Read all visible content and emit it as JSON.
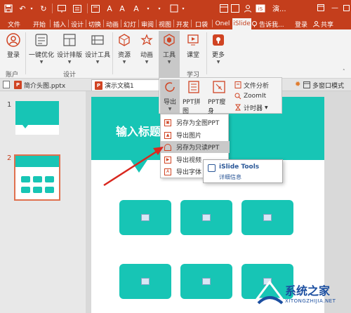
{
  "title_bar": {
    "title": "演...",
    "quick_access": [
      "save-icon",
      "undo-icon",
      "redo-icon",
      "slideshow-icon",
      "new-slide-icon",
      "font-icon",
      "text-color-icon",
      "customize-icon"
    ],
    "ribbon_toggle_icon": "ribbon-display-icon",
    "window_buttons": [
      "minimize-icon",
      "maximize-icon"
    ],
    "brand_color": "#c43e1c"
  },
  "tabs": [
    "文件",
    "开始",
    "插入",
    "设计",
    "切换",
    "动画",
    "幻灯",
    "审阅",
    "视图",
    "开发",
    "口袋",
    "Onel",
    "iSlide"
  ],
  "active_tab": "iSlide",
  "tell_me": "告诉我...",
  "login": "登录",
  "share": "共享",
  "ribbon": {
    "buttons": [
      {
        "label": "登录",
        "icon": "user-icon"
      },
      {
        "label": "一键优化",
        "icon": "optimize-icon"
      },
      {
        "label": "设计排版",
        "icon": "layout-icon"
      },
      {
        "label": "设计工具",
        "icon": "design-tools-icon"
      },
      {
        "label": "资源",
        "icon": "resources-icon"
      },
      {
        "label": "动画",
        "icon": "animation-icon"
      },
      {
        "label": "工具",
        "icon": "tools-icon"
      },
      {
        "label": "课堂",
        "icon": "classroom-icon"
      },
      {
        "label": "更多",
        "icon": "more-icon"
      }
    ],
    "groups": [
      "账户",
      "设计",
      "学习"
    ]
  },
  "tools_panel": {
    "export": "导出",
    "ppt_puzzle": "PPT拼图",
    "ppt_slim": "PPT瘦身",
    "file_analysis": "文件分析",
    "zoomit": "ZoomIt",
    "timer": "计时器"
  },
  "doc_tabs": [
    {
      "name": "简介头图.pptx",
      "active": false
    },
    {
      "name": "演示文稿1",
      "active": true
    }
  ],
  "multi_window": "多窗口模式",
  "thumbnails": [
    {
      "number": "1",
      "selected": false
    },
    {
      "number": "2",
      "selected": true
    }
  ],
  "slide": {
    "title": "输入标题",
    "accent_color": "#17c5b5"
  },
  "export_menu": [
    {
      "label": "另存为全图PPT",
      "icon": "image-icon",
      "highlighted": false
    },
    {
      "label": "导出图片",
      "icon": "picture-icon",
      "highlighted": false
    },
    {
      "label": "另存为只读PPT",
      "icon": "lock-icon",
      "highlighted": true
    },
    {
      "label": "导出视频",
      "icon": "video-icon",
      "highlighted": false
    },
    {
      "label": "导出字体",
      "icon": "font-icon",
      "highlighted": false
    }
  ],
  "tooltip": {
    "title": "iSlide Tools",
    "subtitle": "详细信息"
  },
  "watermark": {
    "text": "系统之家",
    "sub": "XITONGZHIJIA.NET"
  }
}
